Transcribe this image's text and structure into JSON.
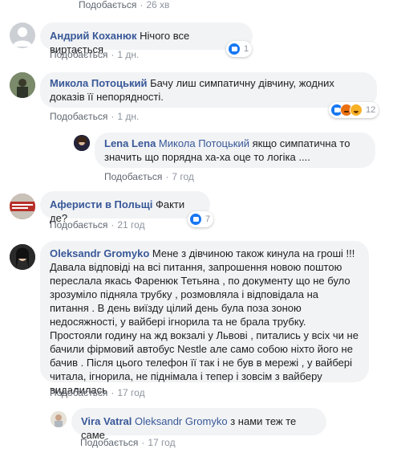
{
  "top_meta": {
    "like": "Подобається",
    "time": "26 хв"
  },
  "comments": [
    {
      "author": "Андрий Коханюк",
      "text": "Нічого все виртається",
      "like": "Подобається",
      "time": "1 дн.",
      "reactions": {
        "count": "1",
        "types": [
          "like"
        ]
      }
    },
    {
      "author": "Микола Потоцький",
      "text": "Бачу лиш симпатичну дівчину, жодних доказів її непорядності.",
      "like": "Подобається",
      "time": "1 дн.",
      "reactions": {
        "count": "12",
        "types": [
          "like",
          "angry",
          "haha"
        ]
      },
      "reply": {
        "author": "Lena Lena",
        "tag": "Микола Потоцький",
        "text": "якщо симпатична то значить що порядна ха-ха оце то логіка ....",
        "like": "Подобається",
        "time": "7 год"
      }
    },
    {
      "author": "Аферисти в Польщі",
      "text": "Факти де?",
      "like": "Подобається",
      "time": "21 год",
      "reactions": {
        "count": "7",
        "types": [
          "like"
        ]
      }
    },
    {
      "author": "Oleksandr Gromyko",
      "text": "Мене з дівчиною також кинула на гроші !!! Давала відповіді на всі питання, запрошення новою поштою переслала якась Фаренюк Тетьяна , по документу що не було зрозуміло підняла трубку , розмовляла і відповідала на питання . В день виїзду цілий день була поза зоною недосяжності, у вайбері ігнорила та не брала трубку. Простояли годину на жд вокзалі у Львові , питались у всіх чи не бачили фірмовий автобус Nestle але само собою ніхто його не бачив . Після цього телефон її так і не був в мережі , у вайбері читала, ігнорила, не піднімала і тепер і зовсім з вайберу видалилась",
      "like": "Подобається",
      "time": "17 год",
      "reply": {
        "author": "Vira Vatral",
        "tag": "Oleksandr Gromyko",
        "text": "з нами теж те саме",
        "like": "Подобається",
        "time": "17 год"
      }
    }
  ],
  "colors": {
    "bubble": "#f2f3f5",
    "name": "#385898",
    "meta": "#8d949e"
  },
  "icons": [
    "like-reaction-icon",
    "angry-reaction-icon",
    "haha-reaction-icon"
  ]
}
